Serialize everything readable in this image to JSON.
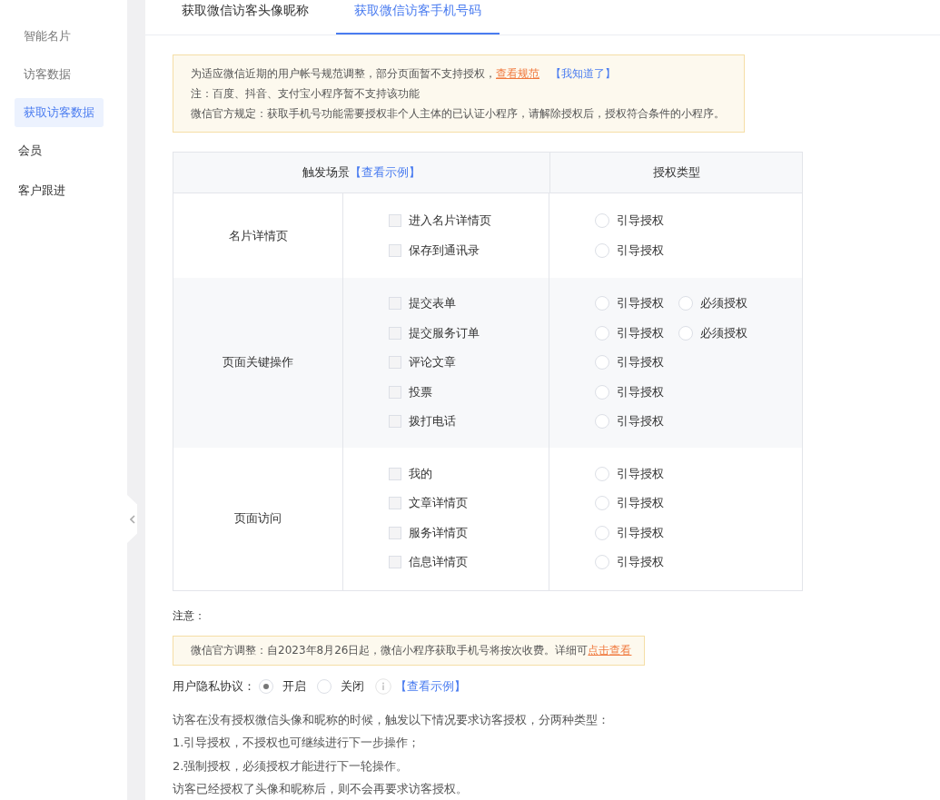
{
  "sidebar": {
    "items": [
      {
        "label": "智能名片",
        "selected": false,
        "kind": "sub"
      },
      {
        "label": "访客数据",
        "selected": false,
        "kind": "sub"
      },
      {
        "label": "获取访客数据",
        "selected": true,
        "kind": "sub"
      },
      {
        "label": "会员",
        "selected": false,
        "kind": "top"
      },
      {
        "label": "客户跟进",
        "selected": false,
        "kind": "top"
      }
    ]
  },
  "tabs": [
    {
      "label": "获取微信访客头像昵称",
      "selected": false
    },
    {
      "label": "获取微信访客手机号码",
      "selected": true
    }
  ],
  "notice": {
    "line_1": "为适应微信近期的用户帐号规范调整，部分页面暂不支持授权，",
    "link": "查看规范",
    "dismiss": "【我知道了】",
    "line_2": "注：百度、抖音、支付宝小程序暂不支持该功能",
    "line_3": "微信官方规定：获取手机号功能需要授权非个人主体的已认证小程序，请解除授权后，授权符合条件的小程序。"
  },
  "table": {
    "header_scene": "触发场景",
    "header_example": "【查看示例】",
    "header_type": "授权类型",
    "groups": [
      {
        "name": "名片详情页",
        "items": [
          {
            "label": "进入名片详情页",
            "checked": false,
            "options": [
              {
                "label": "引导授权",
                "selected": false
              }
            ]
          },
          {
            "label": "保存到通讯录",
            "checked": false,
            "options": [
              {
                "label": "引导授权",
                "selected": false
              }
            ]
          }
        ]
      },
      {
        "name": "页面关键操作",
        "items": [
          {
            "label": "提交表单",
            "checked": false,
            "options": [
              {
                "label": "引导授权",
                "selected": false
              },
              {
                "label": "必须授权",
                "selected": false
              }
            ]
          },
          {
            "label": "提交服务订单",
            "checked": false,
            "options": [
              {
                "label": "引导授权",
                "selected": false
              },
              {
                "label": "必须授权",
                "selected": false
              }
            ]
          },
          {
            "label": "评论文章",
            "checked": false,
            "options": [
              {
                "label": "引导授权",
                "selected": false
              }
            ]
          },
          {
            "label": "投票",
            "checked": false,
            "options": [
              {
                "label": "引导授权",
                "selected": false
              }
            ]
          },
          {
            "label": "拨打电话",
            "checked": false,
            "options": [
              {
                "label": "引导授权",
                "selected": false
              }
            ]
          }
        ]
      },
      {
        "name": "页面访问",
        "items": [
          {
            "label": "我的",
            "checked": false,
            "options": [
              {
                "label": "引导授权",
                "selected": false
              }
            ]
          },
          {
            "label": "文章详情页",
            "checked": false,
            "options": [
              {
                "label": "引导授权",
                "selected": false
              }
            ]
          },
          {
            "label": "服务详情页",
            "checked": false,
            "options": [
              {
                "label": "引导授权",
                "selected": false
              }
            ]
          },
          {
            "label": "信息详情页",
            "checked": false,
            "options": [
              {
                "label": "引导授权",
                "selected": false
              }
            ]
          }
        ]
      }
    ]
  },
  "note_label": "注意：",
  "fee_notice": {
    "text": "微信官方调整：自2023年8月26日起，微信小程序获取手机号将按次收费。详细可",
    "link": "点击查看"
  },
  "privacy": {
    "label": "用户隐私协议：",
    "options": [
      {
        "label": "开启",
        "selected": true
      },
      {
        "label": "关闭",
        "selected": false
      }
    ],
    "example": "【查看示例】"
  },
  "explanation": [
    "访客在没有授权微信头像和昵称的时候，触发以下情况要求访客授权，分两种类型：",
    "1.引导授权，不授权也可继续进行下一步操作；",
    "2.强制授权，必须授权才能进行下一轮操作。",
    "访客已经授权了头像和昵称后，则不会再要求访客授权。"
  ]
}
